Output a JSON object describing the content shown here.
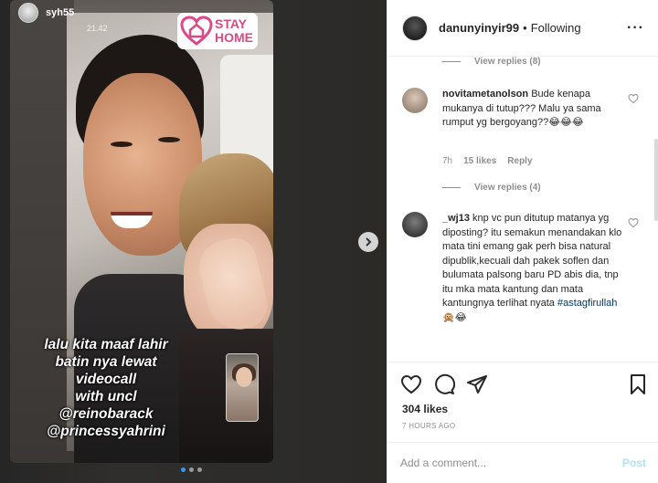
{
  "story": {
    "username": "syh55",
    "time": "21.42",
    "sticker_line1": "STAY",
    "sticker_line2": "HOME",
    "caption_line1": "lalu kita maaf lahir",
    "caption_line2": "batin nya lewat",
    "caption_line3": "videocall",
    "caption_line4": "with uncl",
    "mention1": "@reinobarack",
    "mention2": "@princessyahrini",
    "next_icon": "chevron-right-icon"
  },
  "post": {
    "header": {
      "username": "danunyinyir99",
      "separator": "•",
      "follow_status": "Following",
      "more": "···"
    },
    "view_replies_1": "View replies (8)",
    "comments": [
      {
        "username": "novitametanolson",
        "text": "Bude kenapa mukanya di tutup??? Malu ya sama rumput yg bergoyang??😂😂😂",
        "time": "7h",
        "likes": "15 likes",
        "reply": "Reply"
      },
      {
        "username": "_wj13",
        "text": "knp vc pun ditutup matanya yg diposting? itu semakun menandakan klo mata tini emang gak perh bisa natural dipublik,kecuali dah pakek soflen dan bulumata palsong baru PD abis dia, tnp itu mka mata kantung dan mata kantungnya terlihat nyata",
        "hashtag": "#astagfirullah",
        "emoji": "🙊😂"
      }
    ],
    "view_replies_2": "View replies (4)",
    "likes": "304 likes",
    "time_ago": "7 HOURS AGO",
    "comment_placeholder": "Add a comment...",
    "post_button": "Post"
  },
  "colors": {
    "sticker_pink": "#d94a86",
    "link_blue": "#00376b",
    "post_disabled": "#b2dffc",
    "dot_active": "#3897f0"
  }
}
